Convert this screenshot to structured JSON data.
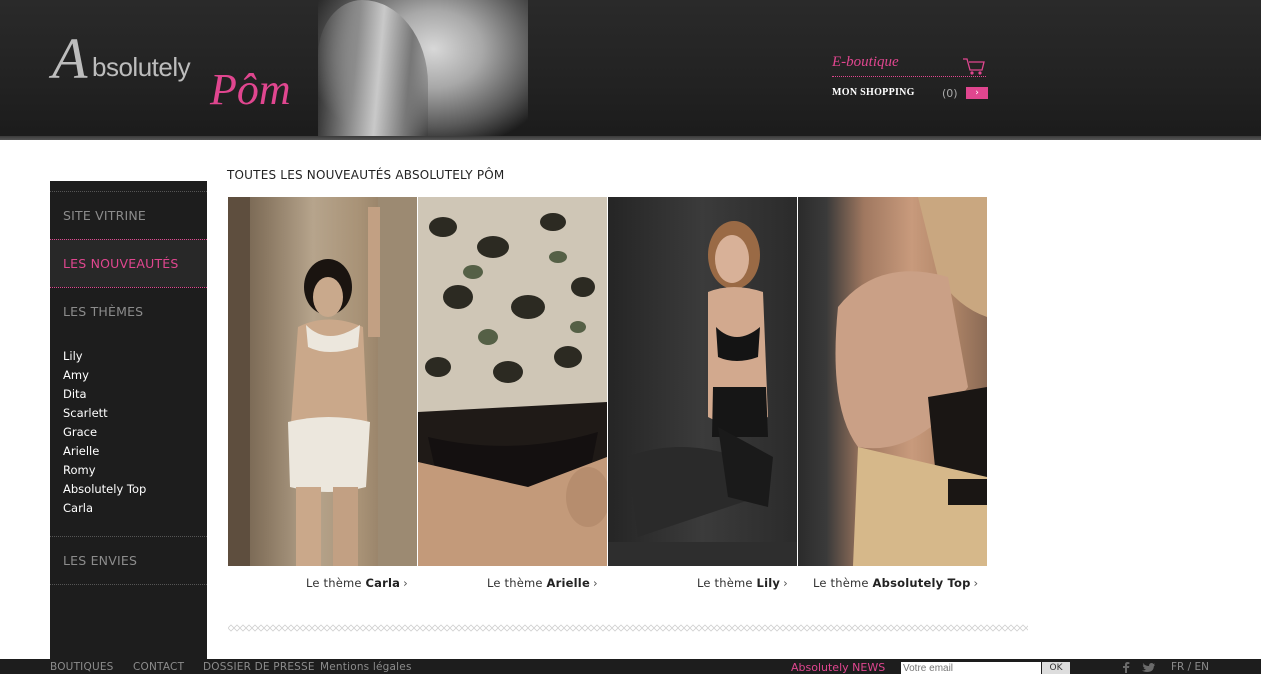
{
  "header": {
    "logo_text": "Absolutely Pôm",
    "eboutique_label": "E-boutique",
    "mon_shopping_label": "MON SHOPPING",
    "cart_count": "(0)",
    "cart_arrow": "›"
  },
  "sidebar": {
    "items": [
      {
        "label": "SITE VITRINE"
      },
      {
        "label": "LES NOUVEAUTÉS"
      },
      {
        "label": "LES THÈMES"
      },
      {
        "label": "LES ENVIES"
      }
    ],
    "themes": [
      "Lily",
      "Amy",
      "Dita",
      "Scarlett",
      "Grace",
      "Arielle",
      "Romy",
      "Absolutely Top",
      "Carla"
    ]
  },
  "main": {
    "title": "TOUTES LES NOUVEAUTÉS ABSOLUTELY PÔM",
    "captions": [
      {
        "prefix": "Le thème",
        "name": "Carla",
        "chev": "›"
      },
      {
        "prefix": "Le thème",
        "name": "Arielle",
        "chev": "›"
      },
      {
        "prefix": "Le thème",
        "name": "Lily",
        "chev": "›"
      },
      {
        "prefix": "Le thème",
        "name": "Absolutely Top",
        "chev": "›"
      }
    ]
  },
  "footer": {
    "links": [
      "BOUTIQUES",
      "CONTACT",
      "DOSSIER DE PRESSE",
      "Mentions légales"
    ],
    "news_label": "Absolutely NEWS",
    "email_placeholder": "Votre email",
    "ok_label": "OK",
    "lang": "FR / EN"
  },
  "colors": {
    "accent": "#e0468f",
    "dark": "#1d1d1d"
  }
}
